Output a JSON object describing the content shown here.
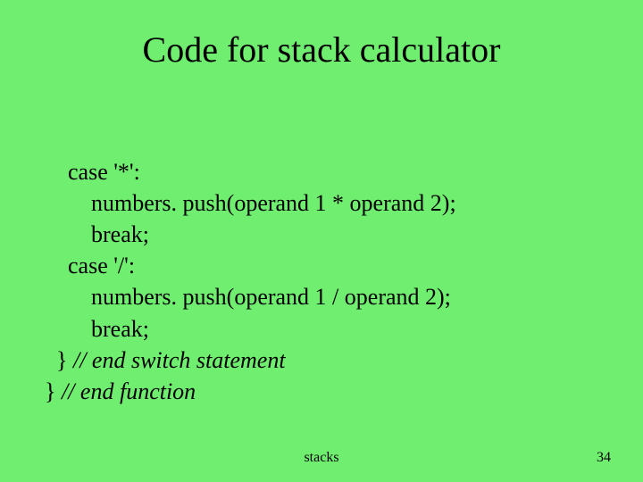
{
  "title": "Code for stack calculator",
  "code": {
    "line1": "case '*':",
    "line2": "numbers. push(operand 1 * operand 2);",
    "line3": "break;",
    "line4": "case '/':",
    "line5": "numbers. push(operand 1 / operand 2);",
    "line6": "break;",
    "comment1_brace": "} ",
    "comment1_text": "// end switch statement",
    "comment2_brace": "} ",
    "comment2_text": "// end function"
  },
  "footer": {
    "label": "stacks",
    "page": "34"
  }
}
